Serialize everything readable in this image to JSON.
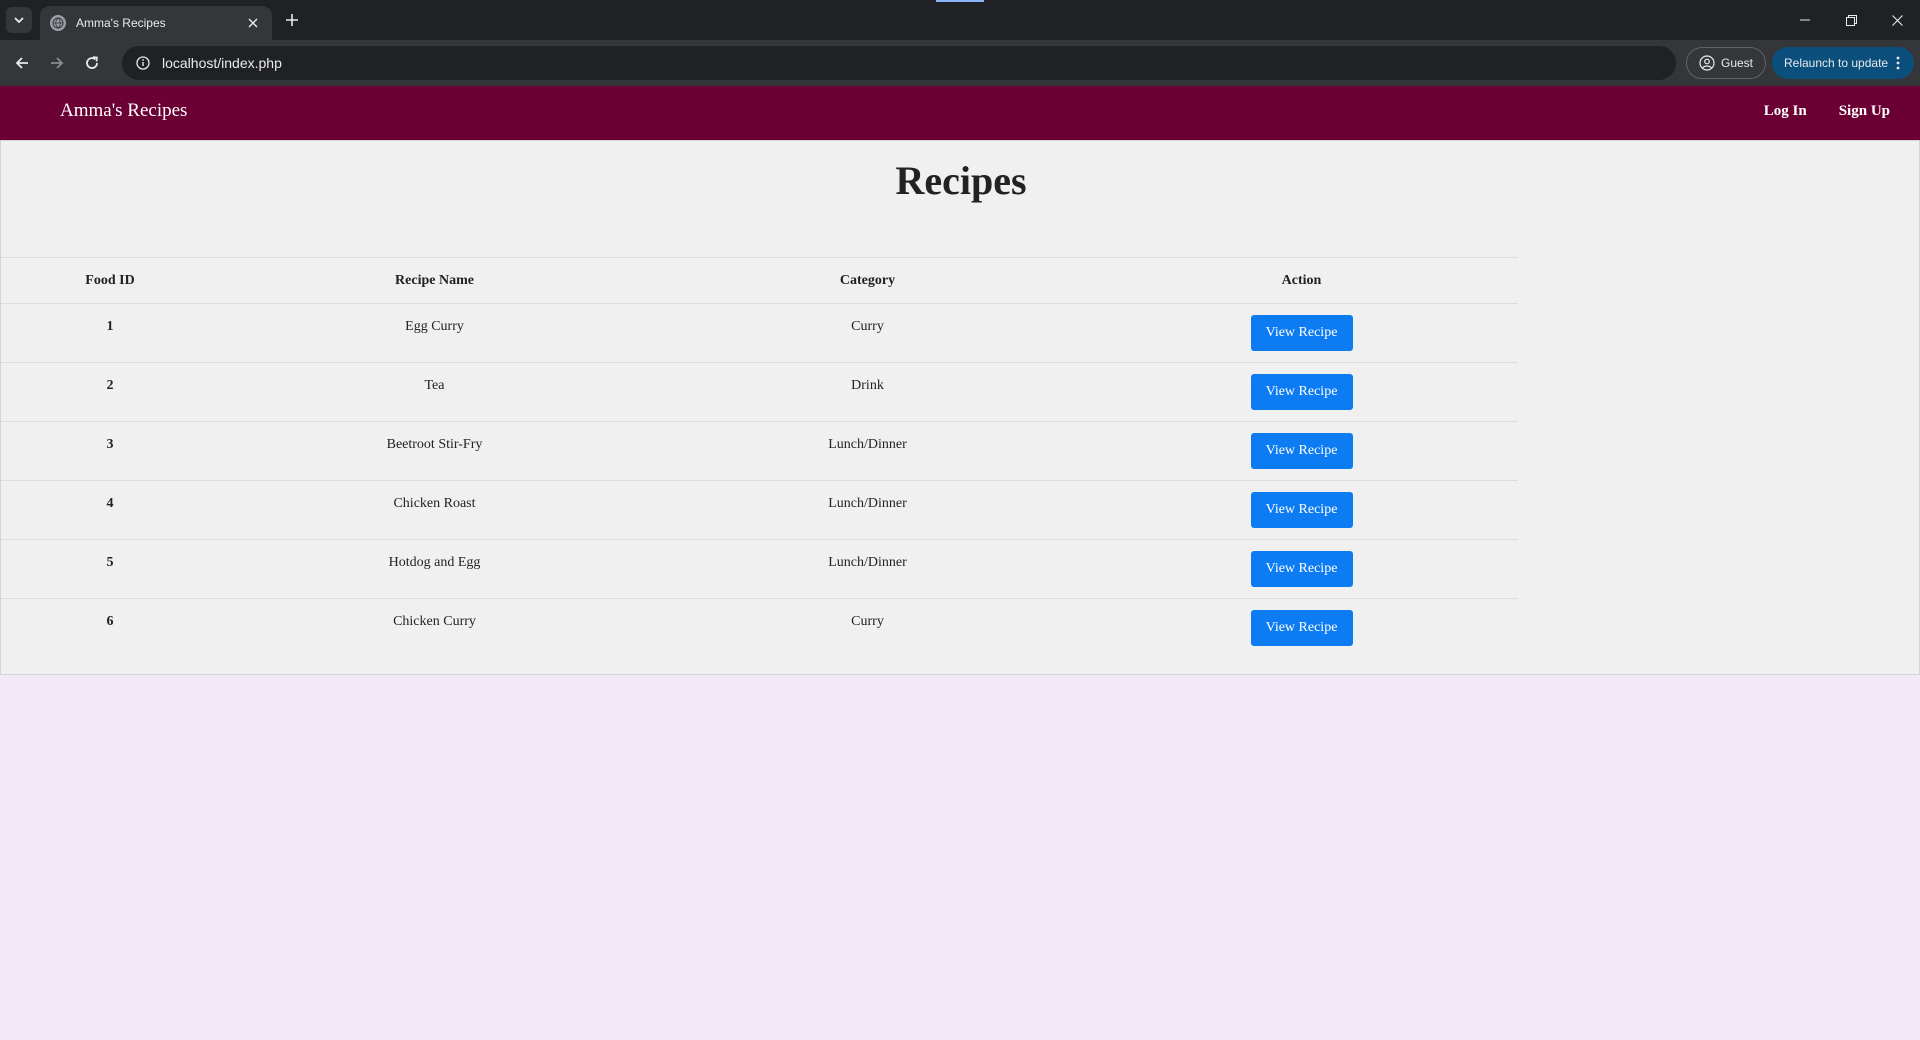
{
  "browser": {
    "tab_title": "Amma's Recipes",
    "url": "localhost/index.php",
    "guest_label": "Guest",
    "relaunch_label": "Relaunch to update"
  },
  "site": {
    "brand": "Amma's Recipes",
    "nav": {
      "login": "Log In",
      "signup": "Sign Up"
    },
    "nav_color": "#6a0033"
  },
  "page": {
    "title": "Recipes",
    "columns": [
      "Food ID",
      "Recipe Name",
      "Category",
      "Action"
    ],
    "rows": [
      {
        "id": "1",
        "name": "Egg Curry",
        "category": "Curry",
        "action": "View Recipe"
      },
      {
        "id": "2",
        "name": "Tea",
        "category": "Drink",
        "action": "View Recipe"
      },
      {
        "id": "3",
        "name": "Beetroot Stir-Fry",
        "category": "Lunch/Dinner",
        "action": "View Recipe"
      },
      {
        "id": "4",
        "name": "Chicken Roast",
        "category": "Lunch/Dinner",
        "action": "View Recipe"
      },
      {
        "id": "5",
        "name": "Hotdog and Egg",
        "category": "Lunch/Dinner",
        "action": "View Recipe"
      },
      {
        "id": "6",
        "name": "Chicken Curry",
        "category": "Curry",
        "action": "View Recipe"
      }
    ],
    "button_color": "#0d7cf2"
  }
}
